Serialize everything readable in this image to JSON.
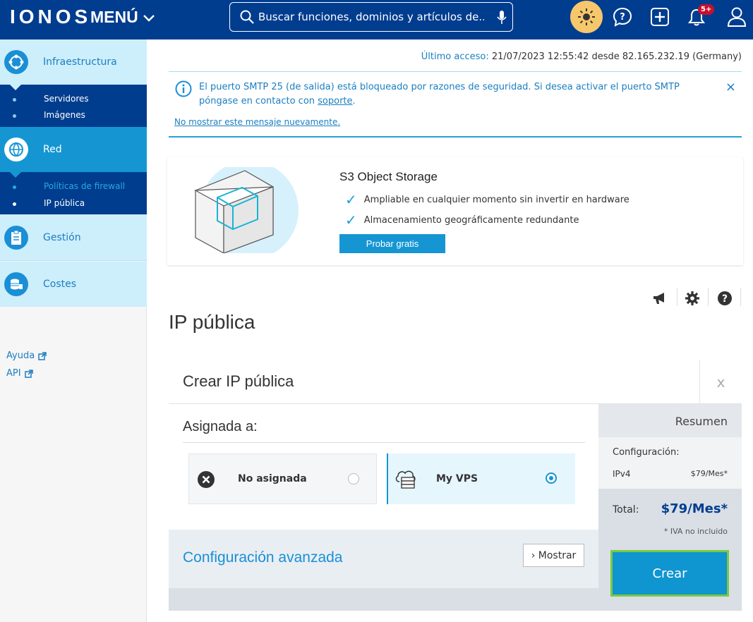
{
  "header": {
    "logo": "IONOS",
    "menu_label": "MENÚ",
    "search_placeholder": "Buscar funciones, dominios y artículos de...",
    "notif_badge": "5+"
  },
  "sidebar": {
    "infra": {
      "label": "Infraestructura",
      "subitems": [
        "Servidores",
        "Imágenes"
      ]
    },
    "red": {
      "label": "Red",
      "subitems": [
        "Políticas de firewall",
        "IP pública"
      ]
    },
    "gestion": {
      "label": "Gestión"
    },
    "costes": {
      "label": "Costes"
    },
    "links": [
      "Ayuda",
      "API"
    ]
  },
  "last_access": {
    "label": "Último acceso:",
    "value": "21/07/2023 12:55:42 desde 82.165.232.19 (Germany)"
  },
  "alert": {
    "message": "El puerto SMTP 25 (de salida) está bloqueado por razones de seguridad. Si desea activar el puerto SMTP póngase en contacto con",
    "link": "soporte",
    "suffix": ".",
    "dismiss": "No mostrar este mensaje nuevamente.",
    "close": "×"
  },
  "promo": {
    "title": "S3 Object Storage",
    "features": [
      "Ampliable en cualquier momento sin invertir en hardware",
      "Almacenamiento geográficamente redundante"
    ],
    "button": "Probar gratis"
  },
  "page_title": "IP pública",
  "card": {
    "title": "Crear IP pública",
    "close": "x",
    "assign_label": "Asignada a:",
    "options": [
      {
        "label": "No asignada",
        "selected": false
      },
      {
        "label": "My VPS",
        "selected": true
      }
    ],
    "advanced": {
      "title": "Configuración avanzada",
      "button": "Mostrar"
    },
    "summary": {
      "title": "Resumen",
      "config_label": "Configuración:",
      "item_label": "IPv4",
      "item_price": "$79/Mes*",
      "total_label": "Total:",
      "total_value": "$79/Mes*",
      "vat_note": "* IVA no incluido",
      "create_button": "Crear"
    }
  },
  "colors": {
    "header": "#003d8f",
    "accent": "#1596d2",
    "highlight": "#7ac943"
  }
}
